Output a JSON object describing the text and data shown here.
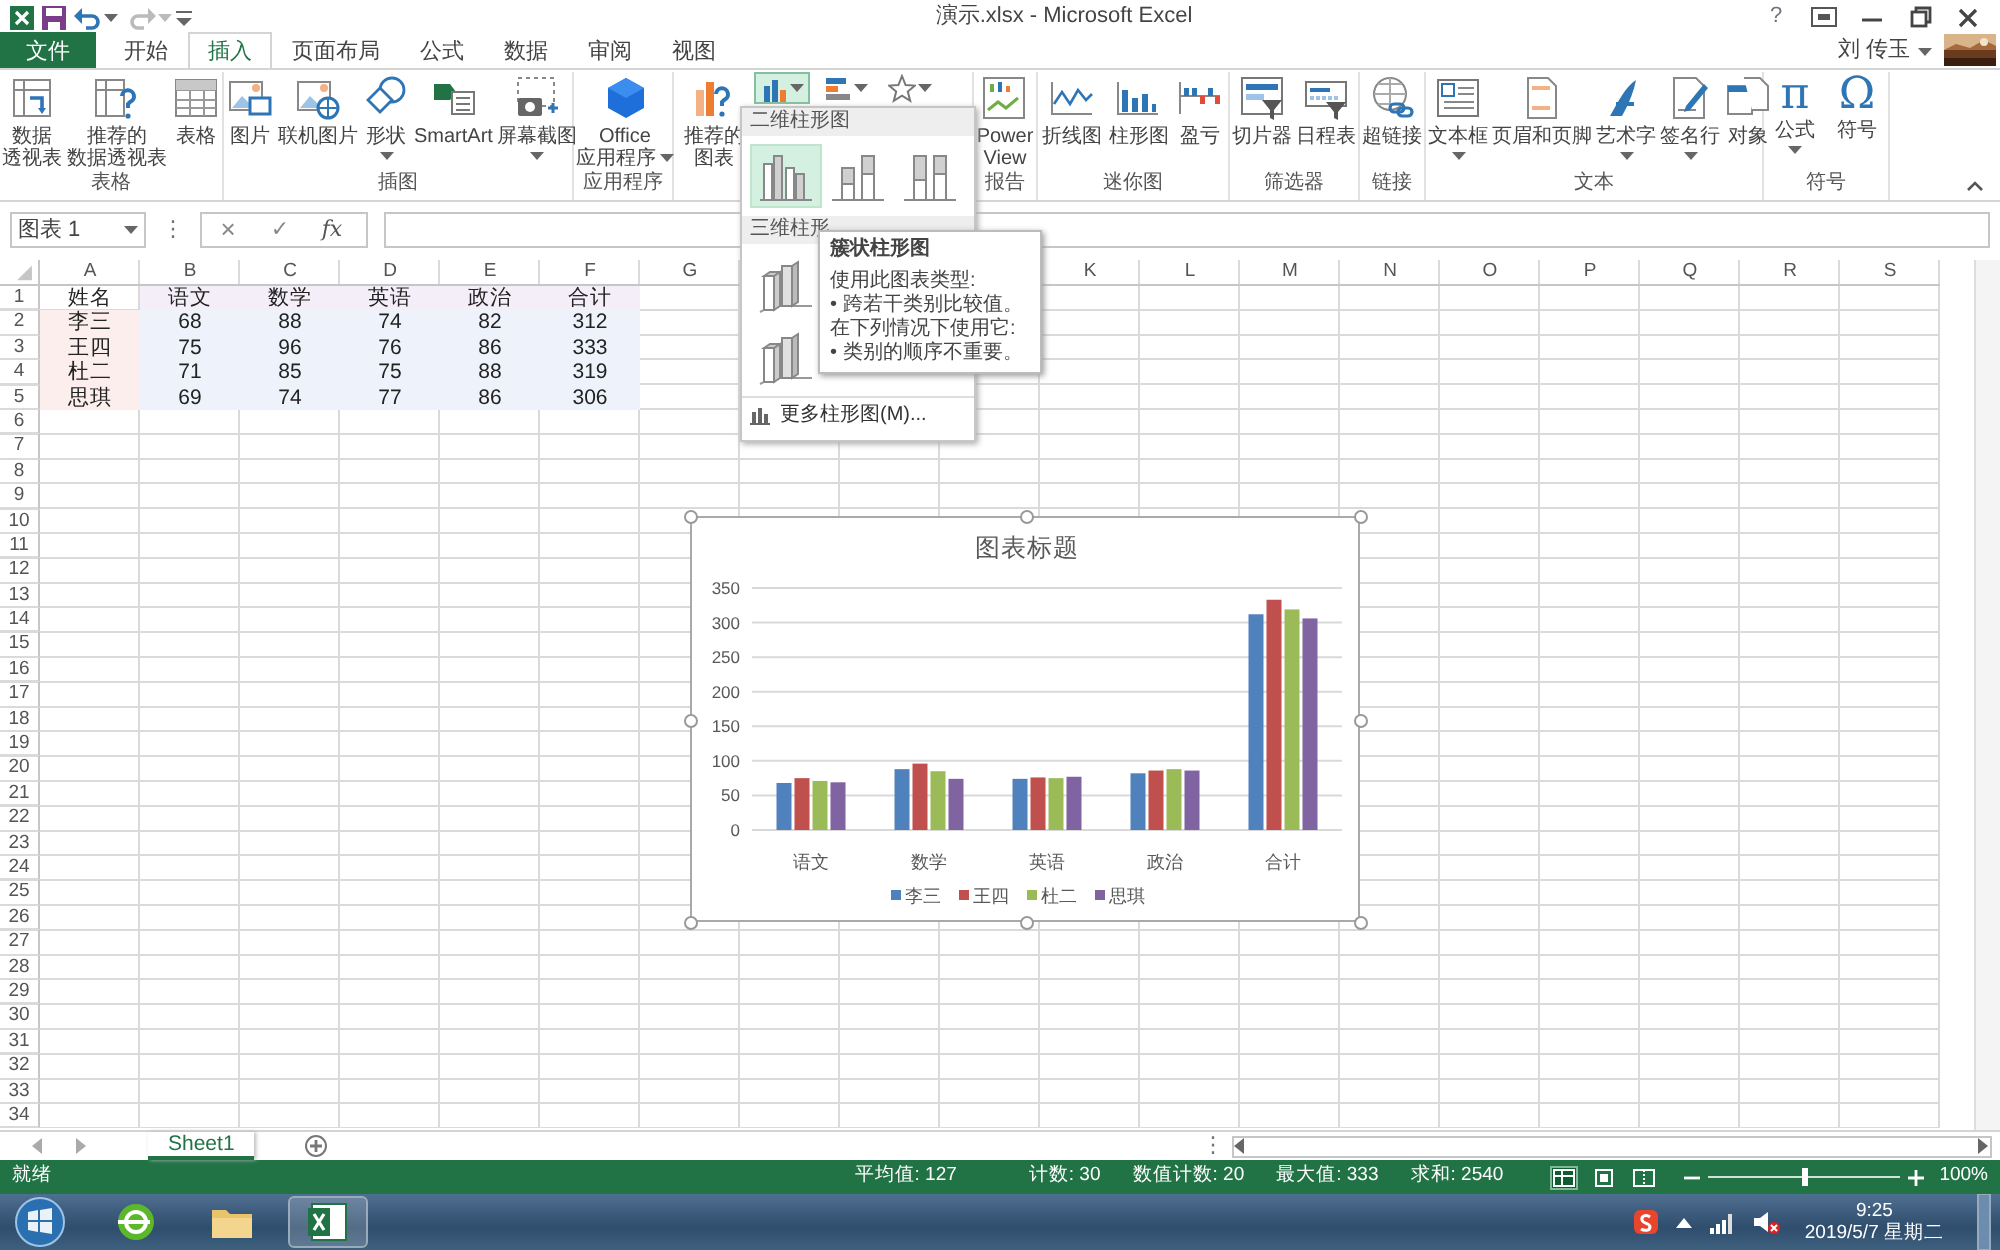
{
  "window": {
    "title": "演示.xlsx - Microsoft Excel",
    "help": "?"
  },
  "account": {
    "user": "刘 传玉"
  },
  "tabs": [
    {
      "label": "文件",
      "kind": "file",
      "selected": false
    },
    {
      "label": "开始",
      "kind": "tab",
      "selected": false
    },
    {
      "label": "插入",
      "kind": "tab",
      "selected": true
    },
    {
      "label": "页面布局",
      "kind": "tab",
      "selected": false
    },
    {
      "label": "公式",
      "kind": "tab",
      "selected": false
    },
    {
      "label": "数据",
      "kind": "tab",
      "selected": false
    },
    {
      "label": "审阅",
      "kind": "tab",
      "selected": false
    },
    {
      "label": "视图",
      "kind": "tab",
      "selected": false
    }
  ],
  "ribbon": {
    "groups": [
      {
        "label": "表格",
        "buttons": [
          {
            "lines": [
              "数据",
              "透视表"
            ],
            "has_menu": false
          },
          {
            "lines": [
              "推荐的",
              "数据透视表"
            ],
            "has_menu": false
          },
          {
            "lines": [
              "表格"
            ],
            "has_menu": false
          }
        ]
      },
      {
        "label": "插图",
        "buttons": [
          {
            "lines": [
              "图片"
            ],
            "has_menu": false
          },
          {
            "lines": [
              "联机图片"
            ],
            "has_menu": false
          },
          {
            "lines": [
              "形状"
            ],
            "has_menu": true
          },
          {
            "lines": [
              "SmartArt"
            ],
            "has_menu": false
          },
          {
            "lines": [
              "屏幕截图"
            ],
            "has_menu": true
          }
        ]
      },
      {
        "label": "应用程序",
        "buttons": [
          {
            "lines": [
              "Office",
              "应用程序"
            ],
            "has_menu": true
          }
        ]
      },
      {
        "kind": "charts",
        "buttons": [
          {
            "lines": [
              "推荐的",
              "图表"
            ],
            "has_menu": false
          }
        ],
        "gallery_buttons": [
          {
            "selected": true,
            "has_menu": true
          },
          {
            "selected": false,
            "has_menu": true
          },
          {
            "selected": false,
            "has_menu": true
          }
        ]
      },
      {
        "label": "报告",
        "buttons": [
          {
            "lines": [
              "Power",
              "View"
            ],
            "has_menu": false
          }
        ]
      },
      {
        "label": "迷你图",
        "buttons": [
          {
            "lines": [
              "折线图"
            ],
            "has_menu": false
          },
          {
            "lines": [
              "柱形图"
            ],
            "has_menu": false
          },
          {
            "lines": [
              "盈亏"
            ],
            "has_menu": false
          }
        ]
      },
      {
        "label": "筛选器",
        "buttons": [
          {
            "lines": [
              "切片器"
            ],
            "has_menu": false
          },
          {
            "lines": [
              "日程表"
            ],
            "has_menu": false
          }
        ]
      },
      {
        "label": "链接",
        "buttons": [
          {
            "lines": [
              "超链接"
            ],
            "has_menu": false
          }
        ]
      },
      {
        "label": "文本",
        "buttons": [
          {
            "lines": [
              "文本框"
            ],
            "has_menu": true
          },
          {
            "lines": [
              "页眉和页脚"
            ],
            "has_menu": false
          },
          {
            "lines": [
              "艺术字"
            ],
            "has_menu": true
          },
          {
            "lines": [
              "签名行"
            ],
            "has_menu": true
          },
          {
            "lines": [
              "对象"
            ],
            "has_menu": false
          }
        ]
      },
      {
        "label": "符号",
        "buttons": [
          {
            "lines": [
              "公式"
            ],
            "glyph": "π",
            "has_menu": true
          },
          {
            "lines": [
              "符号"
            ],
            "glyph": "Ω",
            "has_menu": false
          }
        ]
      }
    ]
  },
  "formula_bar": {
    "name_box": "图表 1",
    "more": "⋮",
    "cancel": "×",
    "enter": "✓",
    "function": "fx"
  },
  "sheet": {
    "columns": [
      {
        "letter": "A",
        "name_column": true
      },
      {
        "letter": "B",
        "name_column": false
      },
      {
        "letter": "C",
        "name_column": false
      },
      {
        "letter": "D",
        "name_column": false
      },
      {
        "letter": "E",
        "name_column": false
      },
      {
        "letter": "F",
        "name_column": false
      },
      {
        "letter": "G"
      },
      {},
      {},
      {},
      {
        "letter": "K"
      },
      {
        "letter": "L"
      },
      {
        "letter": "M"
      },
      {
        "letter": "N"
      },
      {
        "letter": "O"
      },
      {
        "letter": "P"
      },
      {
        "letter": "Q"
      },
      {
        "letter": "R"
      },
      {
        "letter": "S"
      }
    ],
    "rows": [
      {
        "number": "1",
        "header_row": true,
        "cells": [
          "姓名",
          "语文",
          "数学",
          "英语",
          "政治",
          "合计"
        ]
      },
      {
        "number": "2",
        "header_row": false,
        "cells": [
          "李三",
          "68",
          "88",
          "74",
          "82",
          "312"
        ]
      },
      {
        "number": "3",
        "header_row": false,
        "cells": [
          "王四",
          "75",
          "96",
          "76",
          "86",
          "333"
        ]
      },
      {
        "number": "4",
        "header_row": false,
        "cells": [
          "杜二",
          "71",
          "85",
          "75",
          "88",
          "319"
        ]
      },
      {
        "number": "5",
        "header_row": false,
        "cells": [
          "思琪",
          "69",
          "74",
          "77",
          "86",
          "306"
        ]
      },
      {
        "number": "6"
      },
      {
        "number": "7"
      },
      {
        "number": "8"
      },
      {
        "number": "9"
      },
      {
        "number": "10"
      },
      {
        "number": "11"
      },
      {
        "number": "12"
      },
      {
        "number": "13"
      },
      {
        "number": "14"
      },
      {
        "number": "15"
      },
      {
        "number": "16"
      },
      {
        "number": "17"
      },
      {
        "number": "18"
      },
      {
        "number": "19"
      },
      {
        "number": "20"
      },
      {
        "number": "21"
      },
      {
        "number": "22"
      },
      {
        "number": "23"
      },
      {
        "number": "24"
      },
      {
        "number": "25"
      },
      {
        "number": "26"
      },
      {
        "number": "27"
      },
      {
        "number": "28"
      },
      {
        "number": "29"
      },
      {
        "number": "30"
      },
      {
        "number": "31"
      },
      {
        "number": "32"
      },
      {
        "number": "33"
      },
      {
        "number": "34"
      }
    ]
  },
  "chart": {
    "selected": true,
    "chart_data": {
      "type": "bar",
      "title": "图表标题",
      "categories": [
        "语文",
        "数学",
        "英语",
        "政治",
        "合计"
      ],
      "series": [
        {
          "name": "李三",
          "color": "#4f81bd",
          "values": [
            68,
            88,
            74,
            82,
            312
          ]
        },
        {
          "name": "王四",
          "color": "#c0504d",
          "values": [
            75,
            96,
            76,
            86,
            333
          ]
        },
        {
          "name": "杜二",
          "color": "#9bbb59",
          "values": [
            71,
            85,
            75,
            88,
            319
          ]
        },
        {
          "name": "思琪",
          "color": "#8064a2",
          "values": [
            69,
            74,
            77,
            86,
            306
          ]
        }
      ],
      "ylim": [
        0,
        350
      ],
      "yticks": [
        0,
        50,
        100,
        150,
        200,
        250,
        300,
        350
      ],
      "grid": true,
      "legend": "bottom"
    }
  },
  "gallery_menu": {
    "sections": [
      {
        "title": "二维柱形图",
        "kind": "flat",
        "items": [
          {
            "selected": true
          },
          {
            "selected": false
          },
          {
            "selected": false
          }
        ]
      },
      {
        "title": "三维柱形",
        "kind": "solid",
        "items": [
          {
            "selected": false
          },
          {
            "selected": false
          }
        ]
      }
    ],
    "more": "更多柱形图(M)..."
  },
  "tooltip": {
    "title": "簇状柱形图",
    "lines": [
      "使用此图表类型:",
      "• 跨若干类别比较值。",
      "在下列情况下使用它:",
      "• 类别的顺序不重要。"
    ]
  },
  "sheet_bar": {
    "tabs": [
      {
        "label": "Sheet1",
        "selected": true
      }
    ],
    "splitter": "⋮"
  },
  "status_bar": {
    "mode": "就绪",
    "stats": [
      "平均值: 127",
      "计数: 30",
      "数值计数: 20",
      "最大值: 333",
      "求和: 2540"
    ],
    "views": [
      {
        "selected": true
      },
      {
        "selected": false
      },
      {
        "selected": false
      }
    ],
    "zoom": {
      "level": 0.5,
      "reading": "100%"
    }
  },
  "taskbar": {
    "apps": [
      {
        "selected": false
      },
      {
        "selected": false
      },
      {
        "selected": true
      }
    ],
    "clock": {
      "time": "9:25",
      "date": "2019/5/7 星期二"
    }
  }
}
